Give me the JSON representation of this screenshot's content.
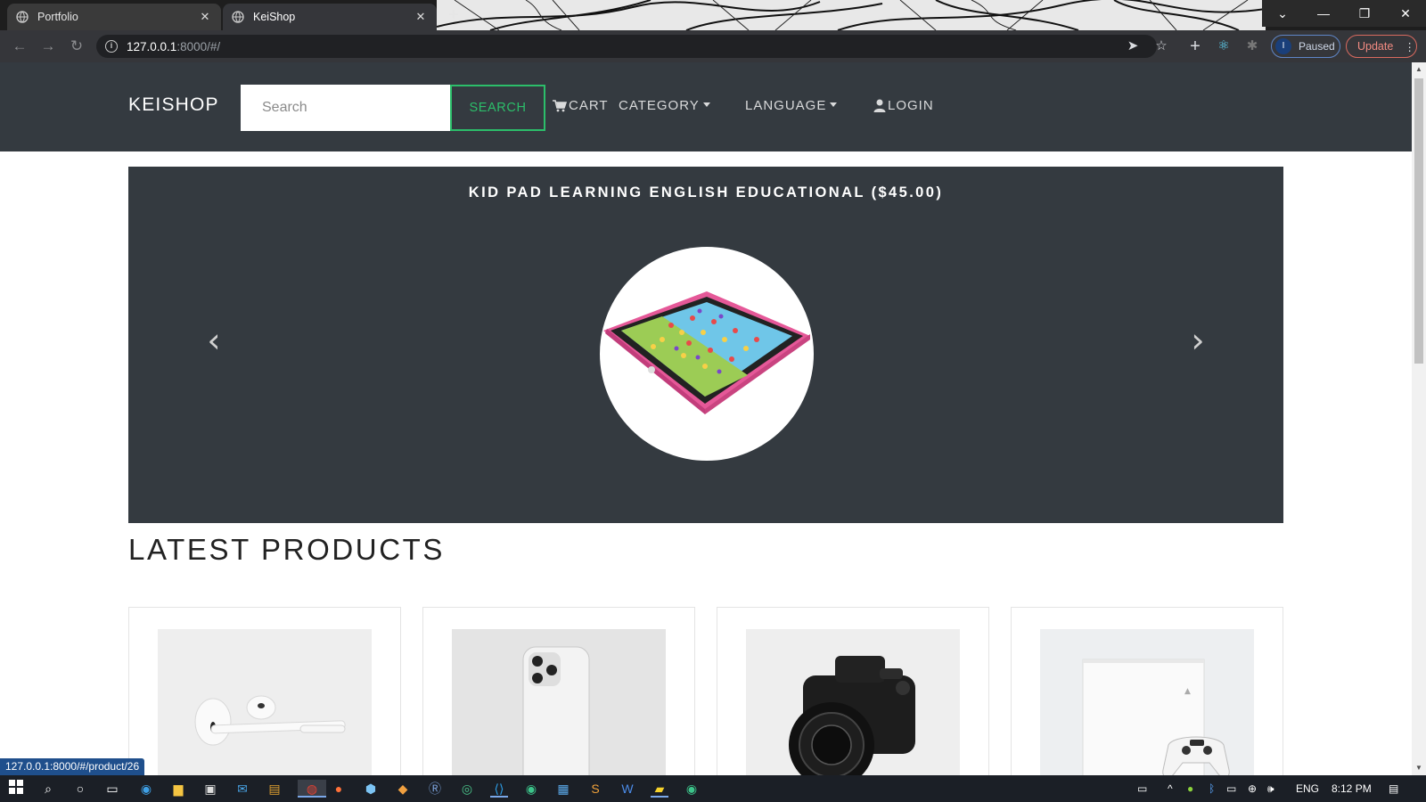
{
  "browser": {
    "tabs": [
      {
        "title": "Portfolio",
        "active": false
      },
      {
        "title": "KeiShop",
        "active": true
      }
    ],
    "url_host": "127.0.0.1",
    "url_rest": ":8000/#/",
    "profile_initial": "I",
    "profile_status": "Paused",
    "update_label": "Update",
    "status_link": "127.0.0.1:8000/#/product/26"
  },
  "navbar": {
    "brand": "KEISHOP",
    "search_placeholder": "Search",
    "search_button": "SEARCH",
    "cart": "CART",
    "category": "CATEGORY",
    "language": "LANGUAGE",
    "login": "LOGIN"
  },
  "carousel": {
    "caption": "KID PAD LEARNING ENGLISH EDUCATIONAL ($45.00)",
    "prev_icon": "chevron-left-icon",
    "next_icon": "chevron-right-icon"
  },
  "latest": {
    "title": "LATEST PRODUCTS",
    "products": [
      {
        "image": "airpods"
      },
      {
        "image": "iphone"
      },
      {
        "image": "camera"
      },
      {
        "image": "playstation"
      }
    ]
  },
  "taskbar": {
    "language": "ENG",
    "time": "8:12 PM"
  },
  "colors": {
    "navbar": "#343a40",
    "accent_green": "#2cbe6a",
    "chrome_dark": "#35363a"
  }
}
